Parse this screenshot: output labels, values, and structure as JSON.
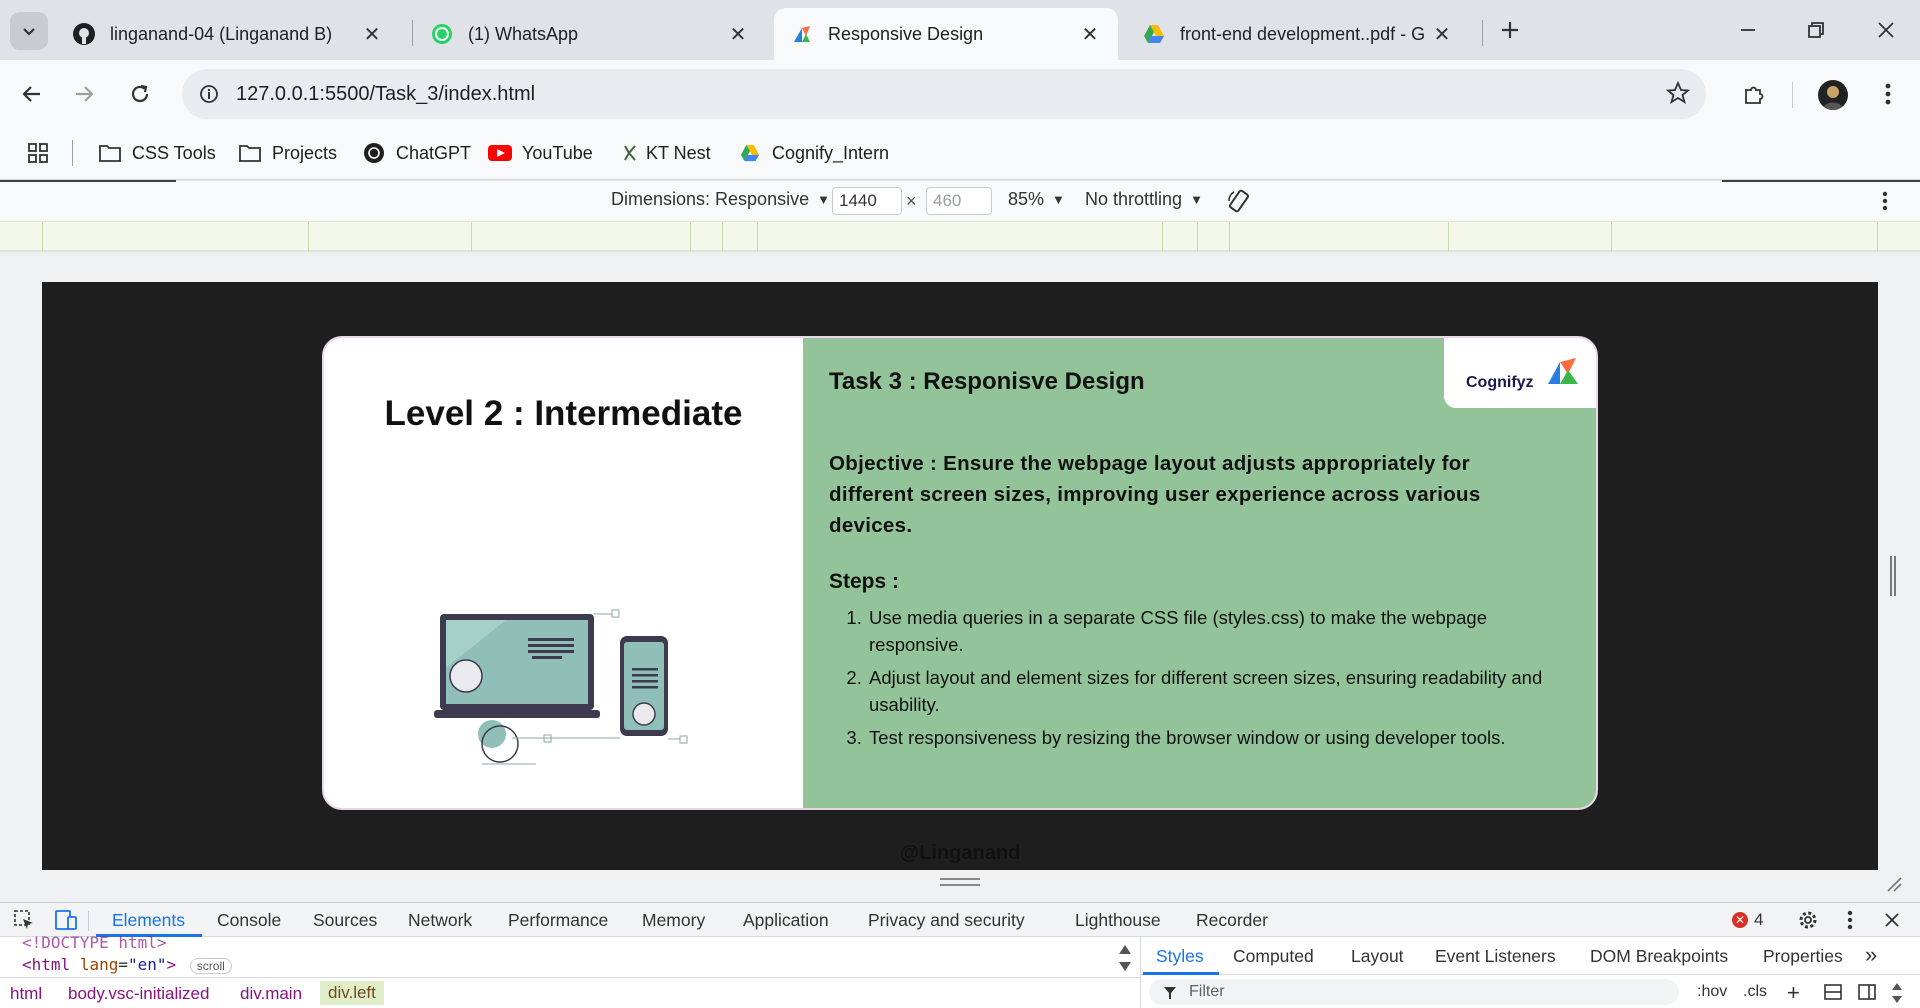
{
  "browser": {
    "tabs": [
      {
        "title": "linganand-04 (Linganand B)",
        "icon": "github-icon"
      },
      {
        "title": "(1) WhatsApp",
        "icon": "whatsapp-icon"
      },
      {
        "title": "Responsive Design",
        "icon": "cognifyz-icon",
        "active": true
      },
      {
        "title": "front-end development..pdf - G",
        "icon": "google-drive-icon"
      }
    ],
    "url": "127.0.0.1:5500/Task_3/index.html",
    "bookmarks": [
      {
        "label": "CSS Tools",
        "icon": "folder-icon"
      },
      {
        "label": "Projects",
        "icon": "folder-icon"
      },
      {
        "label": "ChatGPT",
        "icon": "chatgpt-icon"
      },
      {
        "label": "YouTube",
        "icon": "youtube-icon"
      },
      {
        "label": "KT Nest",
        "icon": "kt-nest-icon"
      },
      {
        "label": "Cognify_Intern",
        "icon": "google-drive-icon"
      }
    ]
  },
  "device_toolbar": {
    "dimensions_label": "Dimensions: Responsive",
    "width": "1440",
    "times": "×",
    "height_placeholder": "460",
    "zoom": "85%",
    "throttling": "No throttling"
  },
  "page": {
    "level_title": "Level 2 : Intermediate",
    "task_title": "Task 3 : Responisve Design",
    "objective": "Objective : Ensure the webpage layout adjusts appropriately for different screen sizes, improving user experience across various devices.",
    "steps_label": "Steps :",
    "steps": [
      "Use media queries in a separate CSS file (styles.css) to make the webpage responsive.",
      "Adjust layout and element sizes for different screen sizes, ensuring readability and usability.",
      "Test responsiveness by resizing the browser window or using developer tools."
    ],
    "logo_text": "Cognifyz",
    "footer_credit": "@Linganand",
    "colors": {
      "right_panel": "#93c499",
      "frame_bg": "#1f1e1e"
    }
  },
  "devtools": {
    "tabs": [
      "Elements",
      "Console",
      "Sources",
      "Network",
      "Performance",
      "Memory",
      "Application",
      "Privacy and security",
      "Lighthouse",
      "Recorder"
    ],
    "error_count": "4",
    "dom": {
      "doctype": "<!DOCTYPE html>",
      "html_open_tag": "<html",
      "html_attr_name": "lang",
      "html_attr_value": "\"en\"",
      "html_close": ">",
      "scroll_badge": "scroll"
    },
    "breadcrumbs": [
      "html",
      "body.vsc-initialized",
      "div.main",
      "div.left"
    ],
    "styles_tabs": [
      "Styles",
      "Computed",
      "Layout",
      "Event Listeners",
      "DOM Breakpoints",
      "Properties"
    ],
    "filter_placeholder": "Filter",
    "hov_label": ":hov",
    "cls_label": ".cls"
  }
}
